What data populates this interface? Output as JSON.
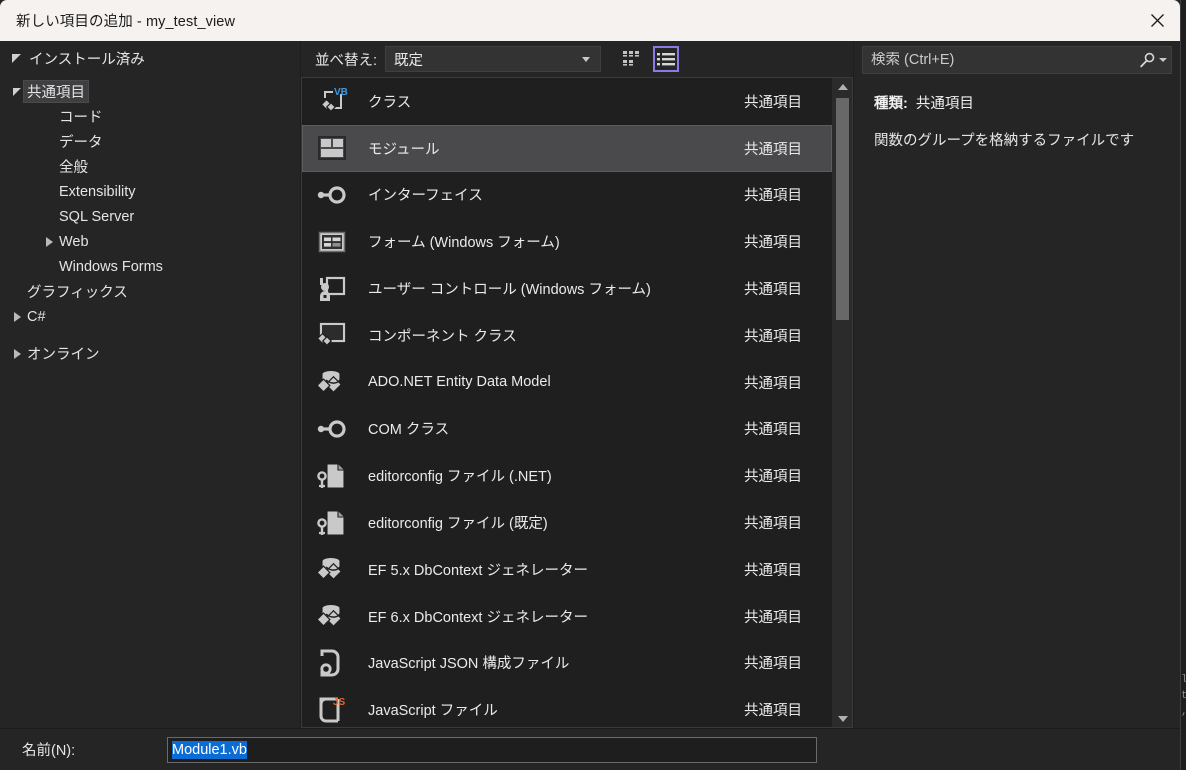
{
  "window": {
    "title": "新しい項目の追加 - my_test_view",
    "close_icon": "close-icon"
  },
  "sidebar": {
    "header": "インストール済み",
    "items": [
      {
        "label": "共通項目",
        "depth": 1,
        "arrow": "down",
        "selected": true
      },
      {
        "label": "コード",
        "depth": 2,
        "arrow": "none",
        "selected": false
      },
      {
        "label": "データ",
        "depth": 2,
        "arrow": "none",
        "selected": false
      },
      {
        "label": "全般",
        "depth": 2,
        "arrow": "none",
        "selected": false
      },
      {
        "label": "Extensibility",
        "depth": 2,
        "arrow": "none",
        "selected": false
      },
      {
        "label": "SQL Server",
        "depth": 2,
        "arrow": "none",
        "selected": false
      },
      {
        "label": "Web",
        "depth": 2,
        "arrow": "right",
        "selected": false
      },
      {
        "label": "Windows Forms",
        "depth": 2,
        "arrow": "none",
        "selected": false
      },
      {
        "label": "グラフィックス",
        "depth": 1,
        "arrow": "none",
        "selected": false
      },
      {
        "label": "C#",
        "depth": 1,
        "arrow": "right",
        "selected": false
      }
    ],
    "online_label": "オンライン"
  },
  "toolbar": {
    "sort_label": "並べ替え:",
    "sort_value": "既定",
    "grid_view_icon": "grid-view-icon",
    "list_view_icon": "list-view-icon",
    "active_view": "list",
    "accent_color": "#8a7ae8"
  },
  "list": {
    "selected_index": 1,
    "items": [
      {
        "name": "クラス",
        "category": "共通項目",
        "icon": "vb-class-icon"
      },
      {
        "name": "モジュール",
        "category": "共通項目",
        "icon": "module-icon"
      },
      {
        "name": "インターフェイス",
        "category": "共通項目",
        "icon": "interface-icon"
      },
      {
        "name": "フォーム (Windows フォーム)",
        "category": "共通項目",
        "icon": "form-icon"
      },
      {
        "name": "ユーザー コントロール (Windows フォーム)",
        "category": "共通項目",
        "icon": "user-control-icon"
      },
      {
        "name": "コンポーネント クラス",
        "category": "共通項目",
        "icon": "component-class-icon"
      },
      {
        "name": "ADO.NET Entity Data Model",
        "category": "共通項目",
        "icon": "entity-data-model-icon"
      },
      {
        "name": "COM クラス",
        "category": "共通項目",
        "icon": "interface-icon"
      },
      {
        "name": "editorconfig ファイル (.NET)",
        "category": "共通項目",
        "icon": "editorconfig-icon"
      },
      {
        "name": "editorconfig ファイル (既定)",
        "category": "共通項目",
        "icon": "editorconfig-icon"
      },
      {
        "name": "EF 5.x DbContext ジェネレーター",
        "category": "共通項目",
        "icon": "entity-data-model-icon"
      },
      {
        "name": "EF 6.x DbContext ジェネレーター",
        "category": "共通項目",
        "icon": "entity-data-model-icon"
      },
      {
        "name": "JavaScript JSON 構成ファイル",
        "category": "共通項目",
        "icon": "json-file-icon"
      },
      {
        "name": "JavaScript ファイル",
        "category": "共通項目",
        "icon": "js-file-icon"
      }
    ]
  },
  "search": {
    "placeholder": "検索 (Ctrl+E)",
    "value": "",
    "icon": "search-icon"
  },
  "details": {
    "kind_label": "種類:",
    "kind_value": "共通項目",
    "description": "関数のグループを格納するファイルです"
  },
  "footer": {
    "name_label": "名前(N):",
    "name_value": "Module1.vb",
    "selection_color": "#0a6cd4"
  },
  "background": {
    "edge_text_lines": [
      "",
      "",
      "",
      "",
      "",
      "",
      "",
      "",
      "",
      "",
      "",
      "",
      "",
      "",
      "",
      "",
      "",
      "",
      "",
      "",
      "",
      "",
      "",
      "",
      "",
      "",
      "",
      "",
      "",
      "",
      "",
      "",
      "",
      "",
      "",
      "",
      "",
      "",
      "",
      "",
      "",
      "",
      "l",
      "t",
      ","
    ]
  }
}
